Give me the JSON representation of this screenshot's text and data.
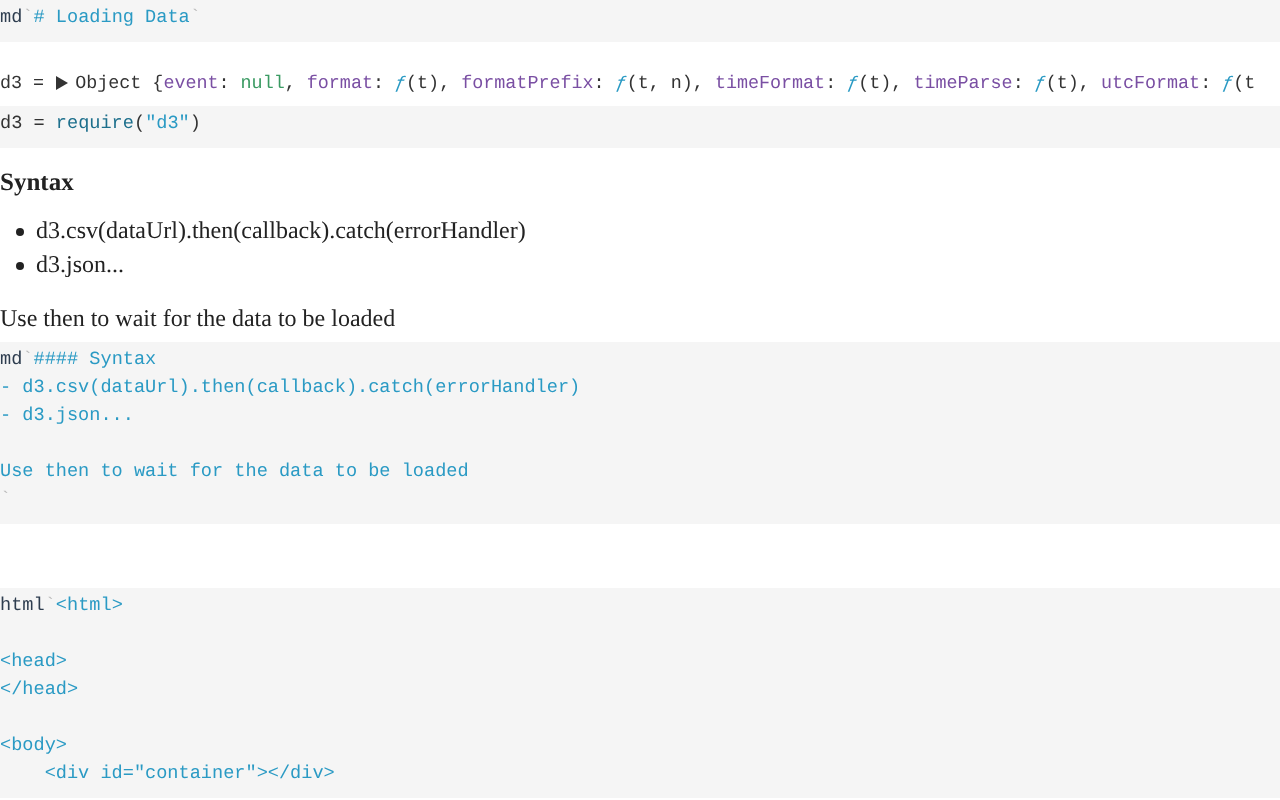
{
  "cells": [
    {
      "kind": "code",
      "lines": [
        {
          "gap_before": false,
          "tokens": [
            {
              "kind": "tag",
              "text": "md"
            },
            {
              "kind": "tick",
              "text": "`"
            },
            {
              "kind": "string",
              "text": "# Loading Data"
            },
            {
              "kind": "tick",
              "text": "`"
            }
          ]
        }
      ]
    },
    {
      "kind": "output",
      "expanded": false,
      "name": "d3 = ",
      "tokens": [
        {
          "kind": "plain",
          "text": "Object {"
        },
        {
          "kind": "key",
          "text": "event"
        },
        {
          "kind": "plain",
          "text": ": "
        },
        {
          "kind": "null",
          "text": "null"
        },
        {
          "kind": "plain",
          "text": ", "
        },
        {
          "kind": "key",
          "text": "format"
        },
        {
          "kind": "plain",
          "text": ": "
        },
        {
          "kind": "func",
          "text": "ƒ"
        },
        {
          "kind": "plain",
          "text": "(t), "
        },
        {
          "kind": "key",
          "text": "formatPrefix"
        },
        {
          "kind": "plain",
          "text": ": "
        },
        {
          "kind": "func",
          "text": "ƒ"
        },
        {
          "kind": "plain",
          "text": "(t, n), "
        },
        {
          "kind": "key",
          "text": "timeFormat"
        },
        {
          "kind": "plain",
          "text": ": "
        },
        {
          "kind": "func",
          "text": "ƒ"
        },
        {
          "kind": "plain",
          "text": "(t), "
        },
        {
          "kind": "key",
          "text": "timeParse"
        },
        {
          "kind": "plain",
          "text": ": "
        },
        {
          "kind": "func",
          "text": "ƒ"
        },
        {
          "kind": "plain",
          "text": "(t), "
        },
        {
          "kind": "key",
          "text": "utcFormat"
        },
        {
          "kind": "plain",
          "text": ": "
        },
        {
          "kind": "func",
          "text": "ƒ"
        },
        {
          "kind": "plain",
          "text": "(t"
        }
      ]
    },
    {
      "kind": "code",
      "lines": [
        {
          "gap_before": false,
          "tokens": [
            {
              "kind": "plain",
              "text": "d3 = "
            },
            {
              "kind": "call",
              "text": "require"
            },
            {
              "kind": "plain",
              "text": "("
            },
            {
              "kind": "string",
              "text": "\"d3\""
            },
            {
              "kind": "plain",
              "text": ")"
            }
          ]
        }
      ]
    },
    {
      "kind": "markdown",
      "heading": "Syntax",
      "bullets": [
        "d3.csv(dataUrl).then(callback).catch(errorHandler)",
        "d3.json..."
      ],
      "paragraph": "Use then to wait for the data to be loaded"
    },
    {
      "kind": "code",
      "lines": [
        {
          "gap_before": false,
          "tokens": [
            {
              "kind": "tag",
              "text": "md"
            },
            {
              "kind": "tick",
              "text": "`"
            },
            {
              "kind": "string",
              "text": "#### Syntax"
            }
          ]
        },
        {
          "gap_before": false,
          "tokens": [
            {
              "kind": "string",
              "text": "- d3.csv(dataUrl).then(callback).catch(errorHandler)"
            }
          ]
        },
        {
          "gap_before": false,
          "tokens": [
            {
              "kind": "string",
              "text": "- d3.json..."
            }
          ]
        },
        {
          "gap_before": true,
          "tokens": [
            {
              "kind": "string",
              "text": "Use then to wait for the data to be loaded"
            }
          ]
        },
        {
          "gap_before": false,
          "tokens": [
            {
              "kind": "tick",
              "text": "`"
            }
          ]
        }
      ]
    },
    {
      "kind": "gap"
    },
    {
      "kind": "code",
      "lines": [
        {
          "gap_before": false,
          "tokens": [
            {
              "kind": "tag",
              "text": "html"
            },
            {
              "kind": "tick",
              "text": "`"
            },
            {
              "kind": "string",
              "text": "<html>"
            }
          ]
        },
        {
          "gap_before": true,
          "tokens": [
            {
              "kind": "string",
              "text": "<head>"
            }
          ]
        },
        {
          "gap_before": false,
          "tokens": [
            {
              "kind": "string",
              "text": "</head>"
            }
          ]
        },
        {
          "gap_before": true,
          "tokens": [
            {
              "kind": "string",
              "text": "<body>"
            }
          ]
        },
        {
          "gap_before": false,
          "tokens": [
            {
              "kind": "string",
              "text": "    <div id=\"container\"></div>"
            }
          ]
        }
      ]
    }
  ]
}
